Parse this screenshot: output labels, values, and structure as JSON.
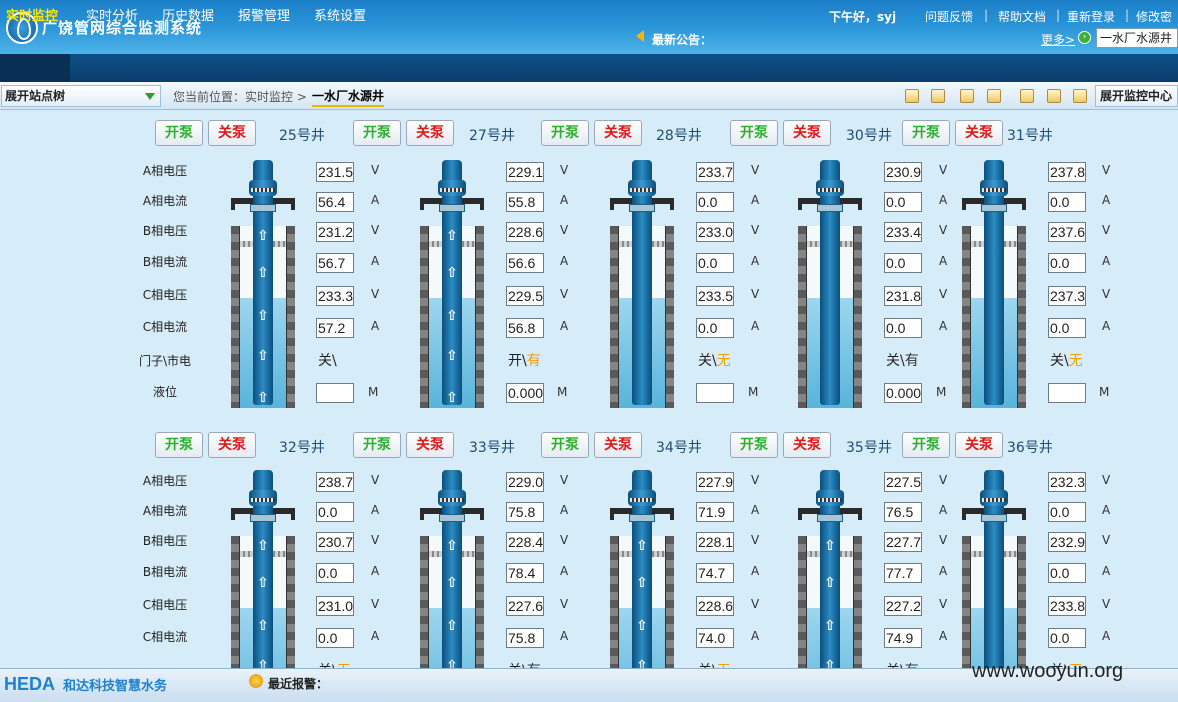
{
  "header": {
    "app_title": "广饶管网综合监测系统",
    "greeting": "下午好，syj",
    "links": [
      "问题反馈",
      "帮助文档",
      "重新登录",
      "修改密码"
    ],
    "notice_label": "最新公告：",
    "more_link": "更多>",
    "station_select": "一水厂水源井"
  },
  "nav": {
    "items": [
      "实时监控",
      "实时分析",
      "历史数据",
      "报警管理",
      "系统设置"
    ],
    "active": "实时监控"
  },
  "toolbar": {
    "tree_button": "展开站点树",
    "breadcrumb": "您当前位置：实时监控 >",
    "current": "一水厂水源井",
    "expand_button": "展开监控中心"
  },
  "labels": {
    "open_pump": "开泵",
    "close_pump": "关泵",
    "rows": [
      "A相电压",
      "A相电流",
      "B相电压",
      "B相电流",
      "C相电压",
      "C相电流",
      "门子\\市电",
      "液位"
    ],
    "units": [
      "V",
      "A",
      "V",
      "A",
      "V",
      "A"
    ],
    "level_unit": "M"
  },
  "wells": [
    {
      "name": "25号井",
      "values": [
        "231.5",
        "56.4",
        "231.2",
        "56.7",
        "233.3",
        "57.2"
      ],
      "gate": "关\\",
      "power": "",
      "level": "",
      "running": true
    },
    {
      "name": "27号井",
      "values": [
        "229.1",
        "55.8",
        "228.6",
        "56.6",
        "229.5",
        "56.8"
      ],
      "gate": "开\\",
      "power": "有",
      "level": "0.000",
      "running": true
    },
    {
      "name": "28号井",
      "values": [
        "233.7",
        "0.0",
        "233.0",
        "0.0",
        "233.5",
        "0.0"
      ],
      "gate": "关\\",
      "power": "无",
      "level": "",
      "running": false
    },
    {
      "name": "30号井",
      "values": [
        "230.9",
        "0.0",
        "233.4",
        "0.0",
        "231.8",
        "0.0"
      ],
      "gate": "关\\",
      "power": "有",
      "level": "0.000",
      "running": false
    },
    {
      "name": "31号井",
      "values": [
        "237.8",
        "0.0",
        "237.6",
        "0.0",
        "237.3",
        "0.0"
      ],
      "gate": "关\\",
      "power": "无",
      "level": "",
      "running": false
    },
    {
      "name": "32号井",
      "values": [
        "238.7",
        "0.0",
        "230.7",
        "0.0",
        "231.0",
        "0.0"
      ],
      "gate": "关\\",
      "power": "无",
      "level": "",
      "running": true
    },
    {
      "name": "33号井",
      "values": [
        "229.0",
        "75.8",
        "228.4",
        "78.4",
        "227.6",
        "75.8"
      ],
      "gate": "关\\",
      "power": "有",
      "level": "",
      "running": true
    },
    {
      "name": "34号井",
      "values": [
        "227.9",
        "71.9",
        "228.1",
        "74.7",
        "228.6",
        "74.0"
      ],
      "gate": "关\\",
      "power": "无",
      "level": "",
      "running": true
    },
    {
      "name": "35号井",
      "values": [
        "227.5",
        "76.5",
        "227.7",
        "77.7",
        "227.2",
        "74.9"
      ],
      "gate": "关\\",
      "power": "有",
      "level": "",
      "running": true
    },
    {
      "name": "36号井",
      "values": [
        "232.3",
        "0.0",
        "232.9",
        "0.0",
        "233.8",
        "0.0"
      ],
      "gate": "关\\",
      "power": "无",
      "level": "",
      "running": false
    }
  ],
  "footer": {
    "brand": "HEDA",
    "brand_tagline": "和达科技智慧水务",
    "alarm_label": "最近报警：",
    "watermark": "www.wooyun.org"
  }
}
